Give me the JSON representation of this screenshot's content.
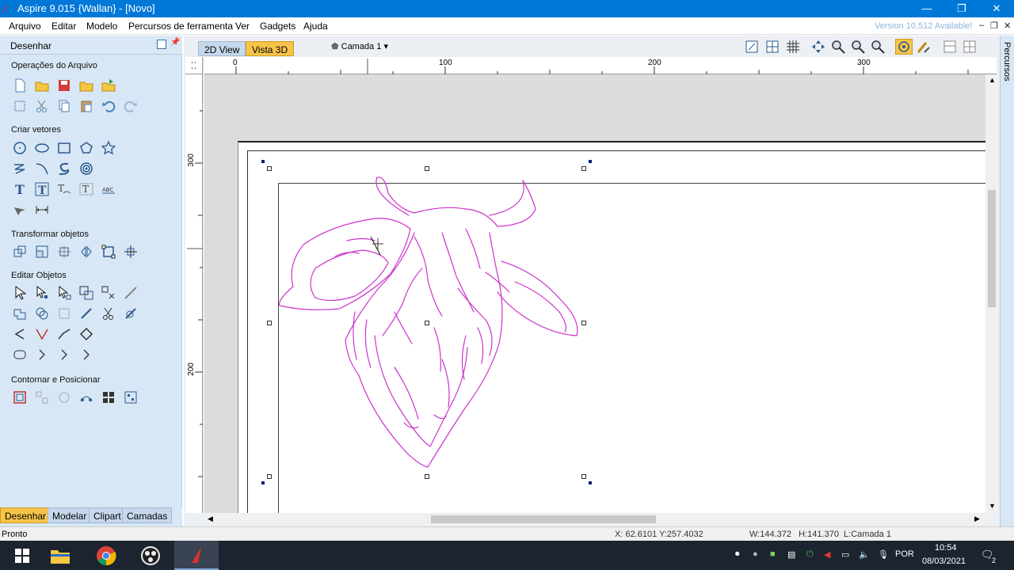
{
  "window": {
    "title": "Aspire 9.015 {Wallan} - [Novo]"
  },
  "menu": {
    "items": [
      "Arquivo",
      "Editar",
      "Modelo",
      "Percursos de ferramenta",
      "Ver",
      "Gadgets",
      "Ajuda"
    ],
    "version": "Version 10.512 Available!"
  },
  "left_panel": {
    "header": "Desenhar",
    "sections": {
      "file_ops": "Operações do Arquivo",
      "create_vectors": "Criar vetores",
      "transform": "Transformar objetos",
      "edit_objects": "Editar Objetos",
      "nesting": "Contornar e Posicionar"
    },
    "tabs": [
      "Desenhar",
      "Modelar",
      "Clipart",
      "Camadas"
    ]
  },
  "view": {
    "tab_2d": "2D View",
    "tab_3d": "Vista 3D",
    "layer": "Camada 1",
    "right_tab": "Percursos"
  },
  "ruler": {
    "top_labels": [
      "0",
      "100",
      "200",
      "300"
    ],
    "left_labels": [
      "300",
      "200"
    ]
  },
  "status": {
    "left": "Pronto",
    "coords": "X: 62.6101 Y:257.4032",
    "dims": "W:144.372   H:141.370  L:Camada 1"
  },
  "taskbar": {
    "lang": "POR",
    "time": "10:54",
    "date": "08/03/2021",
    "notif": "2"
  },
  "colors": {
    "accent": "#0078d7",
    "vector": "#cc33cc",
    "active_tab": "#f6c44a"
  }
}
